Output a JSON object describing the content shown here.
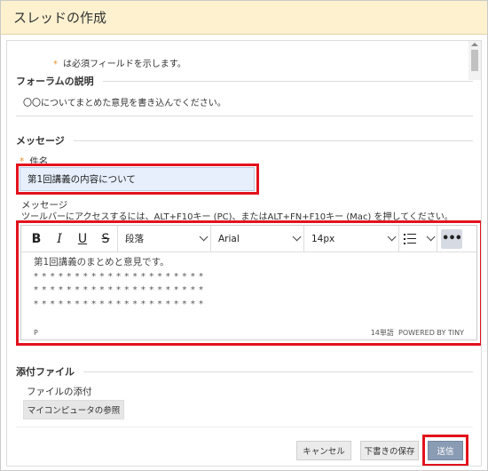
{
  "window": {
    "title": "スレッドの作成"
  },
  "required_note": {
    "star": "*",
    "text": "は必須フィールドを示します。"
  },
  "forum": {
    "legend": "フォーラムの説明",
    "description": "〇〇についてまとめた意見を書き込んでください。"
  },
  "message_section": {
    "legend": "メッセージ",
    "subject_star": "*",
    "subject_label": "件名",
    "subject_value": "第1回講義の内容について",
    "message_label": "メッセージ",
    "toolbar_hint": "ツールバーにアクセスするには、ALT+F10キー (PC)、またはALT+FN+F10キー (Mac) を押してください。"
  },
  "editor": {
    "toolbar": {
      "bold": "B",
      "italic": "I",
      "underline": "U",
      "strike": "S",
      "paragraph": "段落",
      "font": "Arial",
      "size": "14px",
      "more": "•••"
    },
    "body": {
      "line1": "第1回講義のまとめと意見です。",
      "line2": "*********************",
      "line3": "*********************",
      "line4": "*********************"
    },
    "status": {
      "path": "P",
      "word_count": "14単語",
      "powered": "POWERED BY TINY"
    }
  },
  "attachments": {
    "legend": "添付ファイル",
    "label": "ファイルの添付",
    "browse_button": "マイコンピュータの参照"
  },
  "actions": {
    "cancel": "キャンセル",
    "save_draft": "下書きの保存",
    "submit": "送信"
  },
  "colors": {
    "title_bar_bg": "#fdf1cf",
    "required_star": "#e8912e",
    "highlight_box": "#e2121d",
    "subject_bg": "#e6effb",
    "submit_bg": "#8a9bb4"
  }
}
